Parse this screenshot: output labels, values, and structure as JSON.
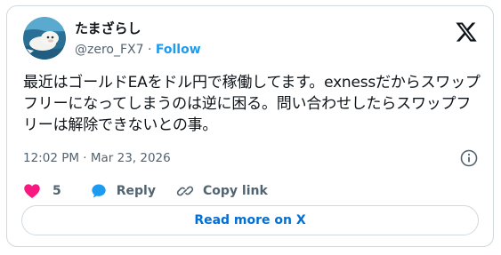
{
  "author": {
    "display_name": "たまざらし",
    "handle": "@zero_FX7",
    "separator": "·",
    "follow_label": "Follow"
  },
  "tweet": {
    "text": "最近はゴールドEAをドル円で稼働してます。exnessだからスワップフリーになってしまうのは逆に困る。問い合わせしたらスワップフリーは解除できないとの事。",
    "timestamp": "12:02 PM · Mar 23, 2026"
  },
  "actions": {
    "like_count": "5",
    "reply_label": "Reply",
    "copy_link_label": "Copy link"
  },
  "read_more_label": "Read more on X",
  "colors": {
    "accent": "#1d9bf0",
    "like": "#f91880",
    "muted_text": "#536471",
    "border": "#cfd9de"
  },
  "icons": [
    "x-logo-icon",
    "info-icon",
    "heart-icon",
    "reply-bubble-icon",
    "link-icon"
  ]
}
